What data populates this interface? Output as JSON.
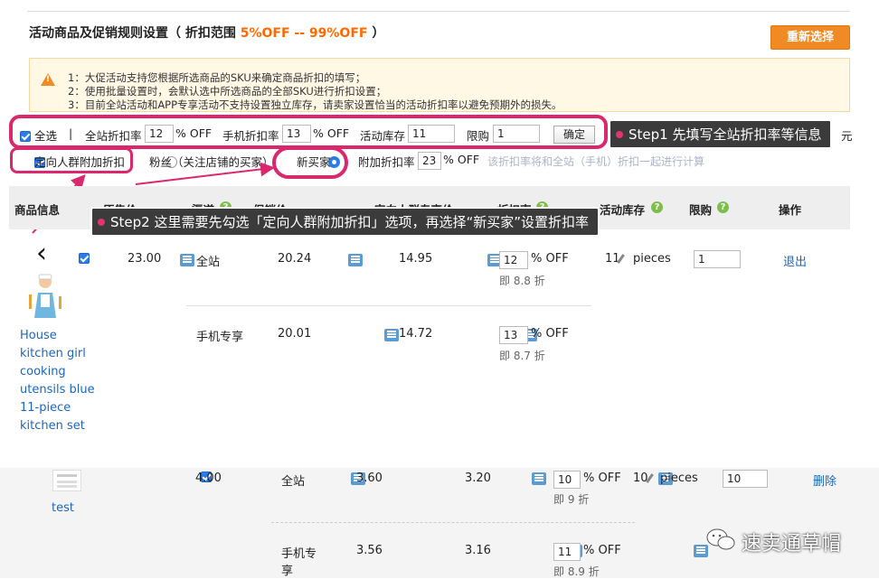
{
  "header": {
    "title_prefix": "活动商品及促销规则设置（ 折扣范围 ",
    "title_range": "5%OFF -- 99%OFF",
    "title_suffix": " ）",
    "reset_button": "重新选择"
  },
  "notice": {
    "lines": [
      "1：大促活动支持您根据所选商品的SKU来确定商品折扣的填写；",
      "2：使用批量设置时，会默认选中所选商品的全部SKU进行折扣设置；",
      "3：目前全站活动和APP专享活动不支持设置独立库存，请卖家设置恰当的活动折扣率以避免预期外的损失。"
    ]
  },
  "batch": {
    "select_all": "全选",
    "divider": "|",
    "site_discount_label": "全站折扣率",
    "site_discount_value": "12",
    "site_discount_unit": "% OFF",
    "mobile_discount_label": "手机折扣率",
    "mobile_discount_value": "13",
    "mobile_discount_unit": "% OFF",
    "stock_label": "活动库存",
    "stock_value": "11",
    "limit_label": "限购",
    "limit_value": "1",
    "confirm": "确定",
    "trailing_text": "元"
  },
  "targeting": {
    "checkbox_label": "定向人群附加折扣",
    "fans_label": "粉丝（关注店铺的买家）",
    "new_buyer_label": "新买家",
    "extra_label": "附加折扣率",
    "extra_value": "23",
    "extra_unit": "% OFF",
    "hint": "该折扣率将和全站（手机）折扣一起进行计算"
  },
  "callouts": {
    "step1": "Step1 先填写全站折扣率等信息",
    "step2": "Step2 这里需要先勾选「定向人群附加折扣」选项，再选择“新买家”设置折扣率"
  },
  "table": {
    "headers": {
      "product": "商品信息",
      "price": "原售价",
      "channel": "渠道",
      "promo_price": "促销价",
      "target_price": "定向人群专享价",
      "discount": "折扣率",
      "stock": "活动库存",
      "limit": "限购",
      "action": "操作"
    },
    "products": [
      {
        "name_lines": [
          "House",
          "kitchen girl",
          "cooking",
          "utensils blue",
          "11-piece",
          "kitchen set"
        ],
        "price": "23.00",
        "stock_value": "11",
        "stock_unit": "pieces",
        "limit_value": "1",
        "action": "退出",
        "rows": [
          {
            "channel": "全站",
            "promo": "20.24",
            "target": "14.95",
            "discount": "12",
            "discount_unit": "% OFF",
            "discount_text": "即 8.8 折"
          },
          {
            "channel": "手机专享",
            "promo": "20.01",
            "target": "14.72",
            "discount": "13",
            "discount_unit": "% OFF",
            "discount_text": "即 8.7 折"
          }
        ]
      },
      {
        "name": "test",
        "price": "4.00",
        "stock_value": "10",
        "stock_unit": "pieces",
        "limit_value": "10",
        "action": "删除",
        "rows": [
          {
            "channel": "全站",
            "promo": "3.60",
            "target": "3.20",
            "discount": "10",
            "discount_unit": "% OFF",
            "discount_text": "即 9 折"
          },
          {
            "channel_line1": "手机专",
            "channel_line2": "享",
            "promo": "3.56",
            "target": "3.16",
            "discount": "11",
            "discount_unit": "% OFF",
            "discount_text": "即 8.9 折"
          }
        ]
      }
    ]
  },
  "watermark": "速卖通草帽",
  "colors": {
    "accent_orange": "#f08a24",
    "highlight_ring": "#d9286e",
    "link_blue": "#1a66c2",
    "checkbox_blue": "#2b7ce9"
  }
}
